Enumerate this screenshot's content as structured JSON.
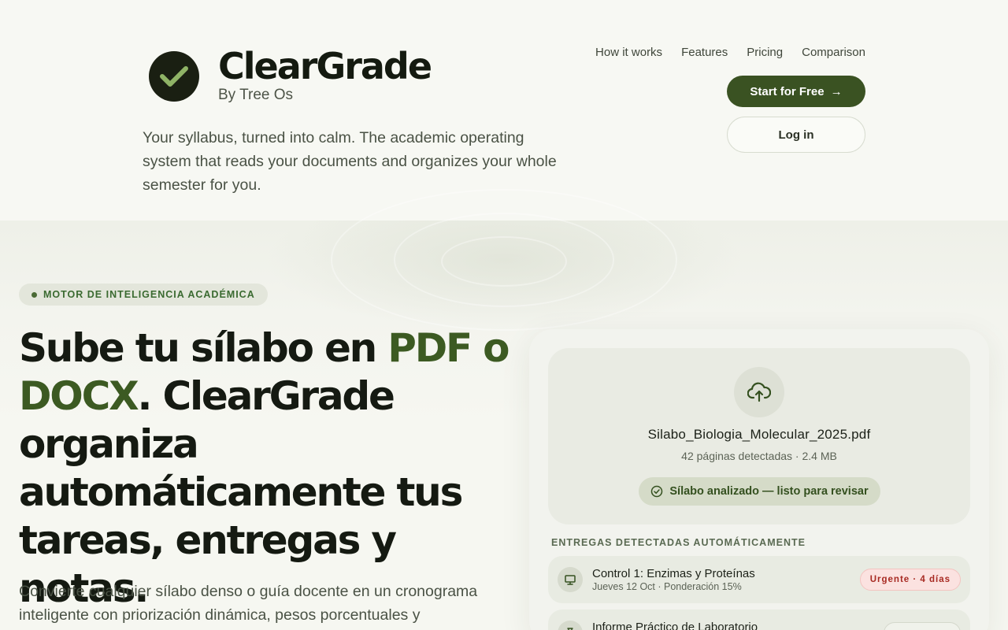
{
  "brand": {
    "name": "ClearGrade",
    "sub": "By Tree Os",
    "tagline": "Your syllabus, turned into calm. The academic operating system that reads your documents and organizes your whole semester for you."
  },
  "nav": {
    "items": [
      "How it works",
      "Features",
      "Pricing",
      "Comparison"
    ],
    "start_label": "Start for Free",
    "start_arrow": "→",
    "login_label": "Log in"
  },
  "hero": {
    "chip": "MOTOR DE INTELIGENCIA ACADÉMICA",
    "headline_part1": "Sube tu sílabo en ",
    "headline_accent": "PDF o DOCX",
    "headline_part2": ". ClearGrade organiza automáticamente tus tareas, entregas y notas.",
    "lead": "Convierte cualquier sílabo denso o guía docente en un cronograma inteligente con priorización dinámica, pesos porcentuales y"
  },
  "upload": {
    "file_name": "Silabo_Biologia_Molecular_2025.pdf",
    "file_meta": "42 páginas detectadas · 2.4 MB",
    "status": "Sílabo analizado — listo para revisar"
  },
  "deliveries": {
    "label": "ENTREGAS DETECTADAS AUTOMÁTICAMENTE",
    "items": [
      {
        "title": "Control 1: Enzimas y Proteínas",
        "meta": "Jueves 12 Oct · Ponderación 15%",
        "badge": "Urgente · 4 días",
        "icon": "presentation-icon"
      },
      {
        "title": "Informe Práctico de Laboratorio",
        "meta": "",
        "badge": "",
        "icon": "flask-icon"
      }
    ]
  },
  "colors": {
    "background": "#f7f8f3",
    "brand_dark": "#1a1f12",
    "accent_green": "#3a5222",
    "check_green": "#8fb366",
    "urgent_red": "#a72a22"
  }
}
